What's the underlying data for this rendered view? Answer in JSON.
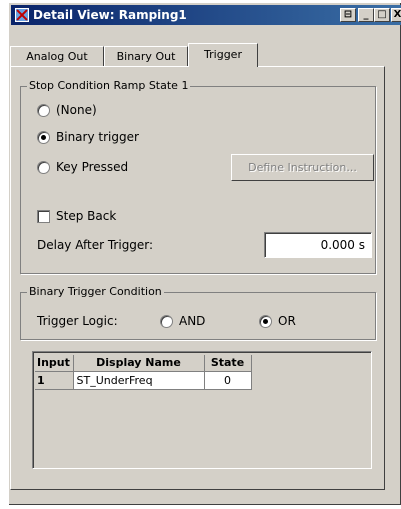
{
  "window": {
    "title": "Detail View: Ramping1"
  },
  "controls": {
    "dock": "⊟",
    "minimize": "_",
    "maximize": "□",
    "close": "X"
  },
  "tabs": [
    {
      "label": "Analog Out",
      "selected": false
    },
    {
      "label": "Binary Out",
      "selected": false
    },
    {
      "label": "Trigger",
      "selected": true
    }
  ],
  "stop_condition": {
    "legend": "Stop Condition Ramp State 1",
    "options": [
      {
        "label": "(None)",
        "checked": false
      },
      {
        "label": "Binary trigger",
        "checked": true
      },
      {
        "label": "Key Pressed",
        "checked": false
      }
    ],
    "define_button": "Define Instruction...",
    "step_back": {
      "label": "Step Back",
      "checked": false
    },
    "delay": {
      "label": "Delay After Trigger:",
      "value": "0.000 s"
    }
  },
  "binary_condition": {
    "legend": "Binary Trigger Condition",
    "logic_label": "Trigger Logic:",
    "options": [
      {
        "label": "AND",
        "checked": false
      },
      {
        "label": "OR",
        "checked": true
      }
    ]
  },
  "grid": {
    "headers": [
      "Input",
      "Display Name",
      "State"
    ],
    "rows": [
      {
        "input": "1",
        "name": "ST_UnderFreq",
        "state": "0"
      }
    ]
  }
}
